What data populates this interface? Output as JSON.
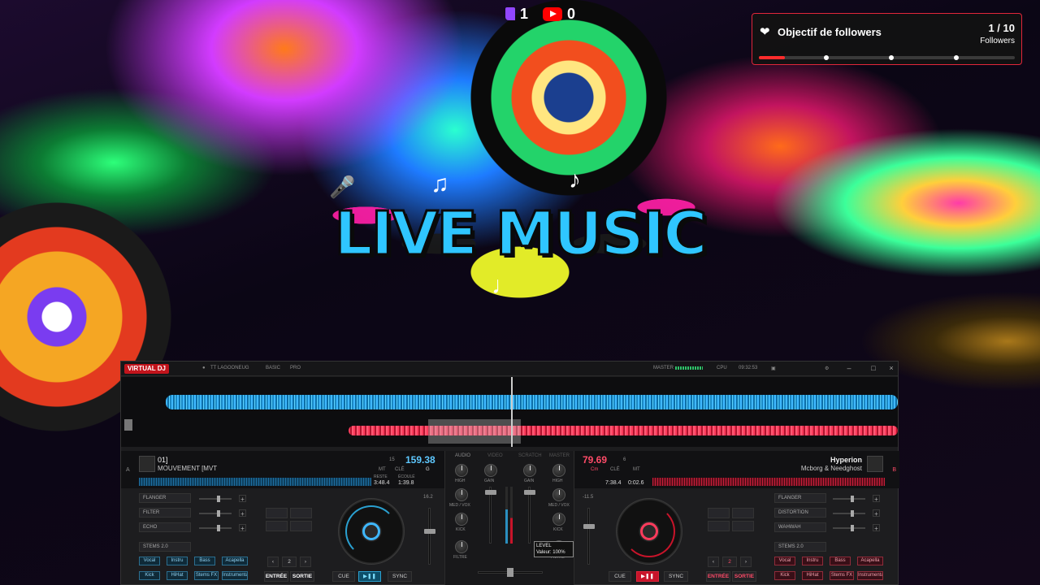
{
  "overlay": {
    "twitch_count": "1",
    "youtube_count": "0",
    "goal": {
      "title": "Objectif de followers",
      "count": "1 / 10",
      "unit": "Followers",
      "progress": 0.1,
      "accent": "#e1263a"
    },
    "banner_text": "LIVE MUSIC"
  },
  "vdj": {
    "logo": "VIRTUAL DJ",
    "user": "TT LAGOONEUG",
    "mode1": "BASIC",
    "mode2": "PRO",
    "master_label": "MASTER",
    "cpu_label": "CPU",
    "clock": "09:32:53",
    "colors": {
      "deck_a": "#3fb8ff",
      "deck_b": "#ff3b5c"
    },
    "deck_a": {
      "letter": "A",
      "number": "01]",
      "title": "MOUVEMENT [MVT",
      "bpm": "159.38",
      "pitch": "15",
      "key_label": "CLÉ",
      "key": "G",
      "mt": "MT",
      "remain_label": "RESTE",
      "elapsed_label": "ÉCOULÉ",
      "remain": "3:48.4",
      "elapsed": "1:39.8",
      "pitch_value": "16.2",
      "fx": [
        "FLANGER",
        "FILTER",
        "ECHO"
      ],
      "stems_label": "STEMS 2.0",
      "stems": [
        "Vocal",
        "Instru",
        "Bass",
        "Acapella",
        "Kick",
        "HiHat",
        "Stems FX",
        "Instrumental"
      ],
      "loop_value": "2",
      "cue_labels": [
        "ENTRÉE",
        "SORTIE"
      ],
      "cue": "CUE",
      "sync": "SYNC",
      "play_icon": "play-pause-icon"
    },
    "deck_b": {
      "letter": "B",
      "title": "Hyperion",
      "artist": "Mcborg & Needghost",
      "bpm": "79.69",
      "pitch": "6",
      "key_label": "CLÉ",
      "key": "Cm",
      "mt": "MT",
      "remain": "7:38.4",
      "elapsed": "0:02.6",
      "pitch_value": "-11.5",
      "fx": [
        "FLANGER",
        "DISTORTION",
        "WAHWAH"
      ],
      "stems_label": "STEMS 2.0",
      "stems": [
        "Vocal",
        "Instru",
        "Bass",
        "Acapella",
        "Kick",
        "HiHat",
        "Stems FX",
        "Instrumental"
      ],
      "loop_value": "2",
      "cue_labels": [
        "ENTRÉE",
        "SORTIE"
      ],
      "cue": "CUE",
      "sync": "SYNC",
      "play_icon": "play-pause-icon"
    },
    "mixer": {
      "tabs": [
        "AUDIO",
        "VIDEO",
        "SCRATCH",
        "MASTER"
      ],
      "labels": [
        "HIGH",
        "GAIN",
        "GAIN",
        "HIGH",
        "MED / VOX",
        "MED / VOX",
        "KICK",
        "KICK",
        "FILTRE",
        "FILTRE"
      ],
      "tooltip_line1": "LEVEL",
      "tooltip_line2": "Valeur: 100%"
    }
  }
}
